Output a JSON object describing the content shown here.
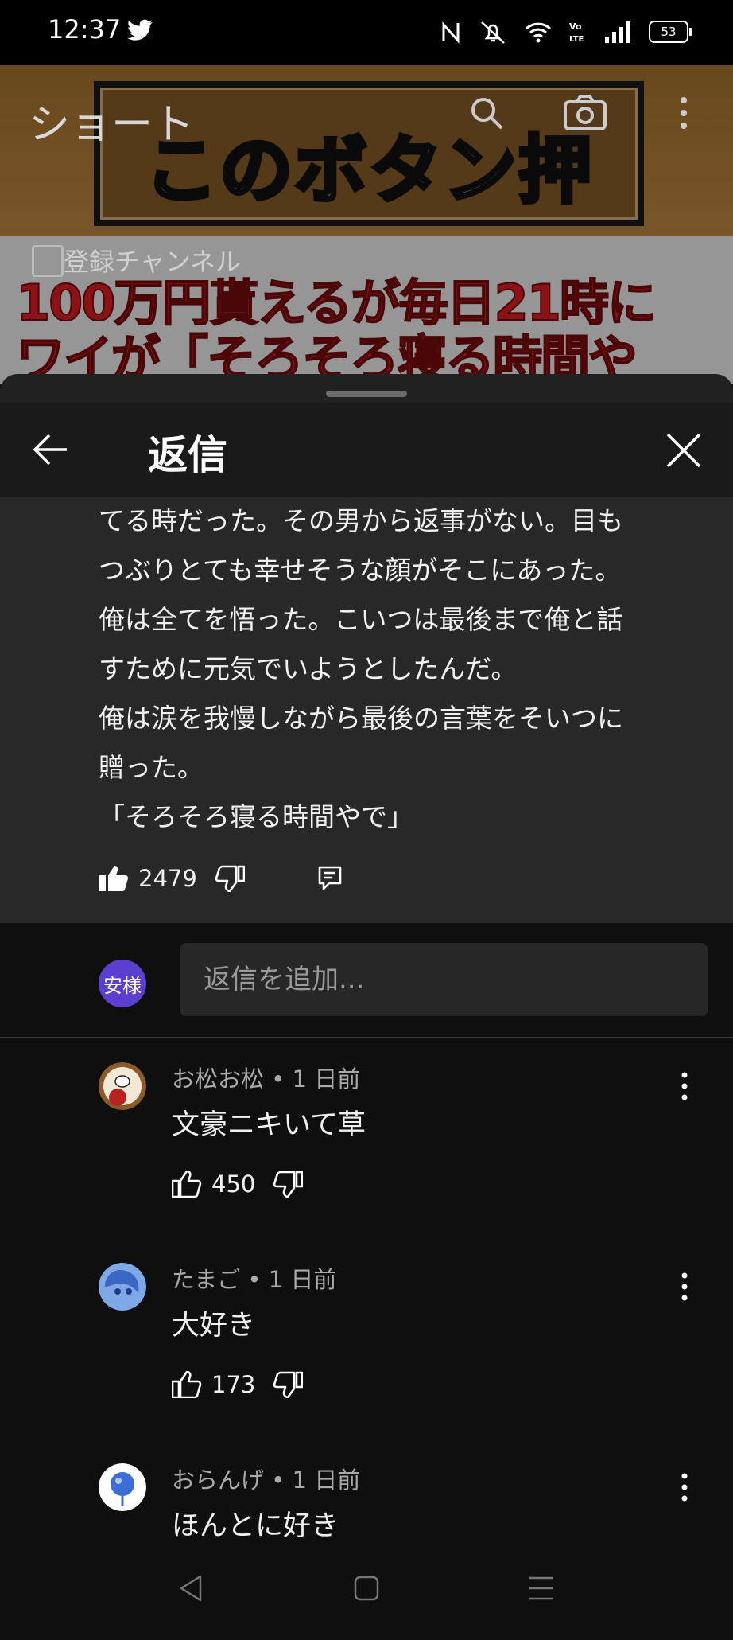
{
  "status_bar": {
    "time": "12:37",
    "battery": "53",
    "icons": [
      "twitter-icon",
      "nfc-icon",
      "mute-icon",
      "wifi-icon",
      "volte-icon",
      "signal-icon",
      "battery-icon"
    ]
  },
  "background": {
    "screen_title": "ショート",
    "subscriptions_label": "登録チャンネル",
    "thumbnail_title": "このボタン押す？",
    "thumbnail_line1": "100万円貰えるが毎日21時に",
    "thumbnail_line2": "ワイが「そろそろ寝る時間や"
  },
  "header": {
    "title": "返信"
  },
  "parent_comment": {
    "lines": [
      "てる時だった。その男から返事がない。目も",
      "つぶりとても幸せそうな顔がそこにあった。",
      "俺は全てを悟った。こいつは最後まで俺と話",
      "すために元気でいようとしたんだ。",
      "俺は涙を我慢しながら最後の言葉をそいつに",
      "贈った。",
      "「そろそろ寝る時間やで」"
    ],
    "like_count": "2479"
  },
  "reply_input": {
    "avatar_text": "安様",
    "placeholder": "返信を追加..."
  },
  "replies": [
    {
      "author": "お松お松",
      "time": "1 日前",
      "text": "文豪ニキいて草",
      "likes": "450"
    },
    {
      "author": "たまご",
      "time": "1 日前",
      "text": "大好き",
      "likes": "173"
    },
    {
      "author": "おらんげ",
      "time": "1 日前",
      "text": "ほんとに好き",
      "likes": ""
    }
  ],
  "colors": {
    "sheet_bg": "#212121",
    "parent_bg": "#282828",
    "page_bg": "#0f0f0f",
    "avatar_me": "#5b3fd1"
  }
}
